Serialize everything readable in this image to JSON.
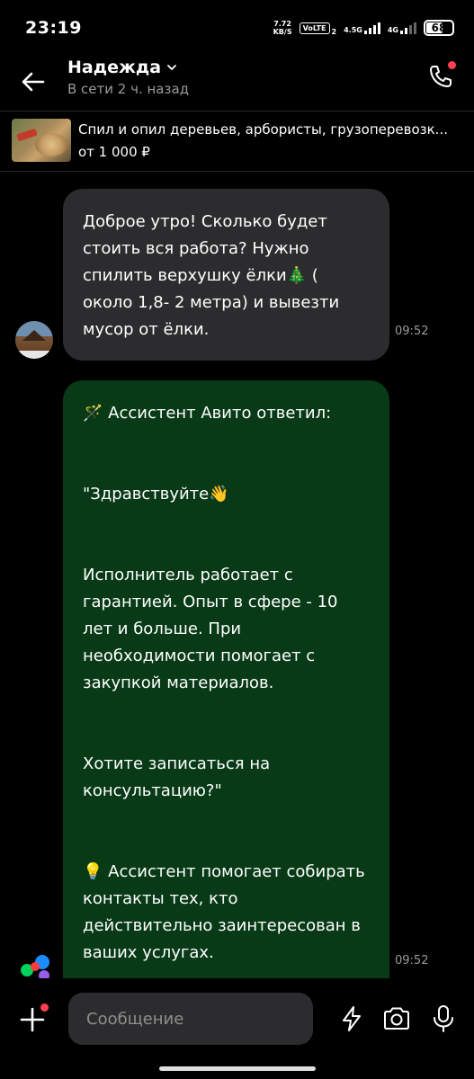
{
  "status_bar": {
    "time": "23:19",
    "speed_value": "7.72",
    "speed_unit": "KB/S",
    "volte": "VoLTE",
    "volte_sim": "2",
    "net1": "4.5G",
    "net2": "4G",
    "battery": "68"
  },
  "header": {
    "contact_name": "Надежда",
    "last_seen": "В сети 2 ч. назад"
  },
  "listing": {
    "title": "Спил и опил деревьев, арбористы, грузоперевозк...",
    "price": "от 1 000 ₽"
  },
  "messages": [
    {
      "text": "Доброе утро! Сколько будет стоить вся работа? Нужно спилить верхушку ёлки🎄 ( около 1,8- 2 метра) и вывезти мусор от ёлки.",
      "time": "09:52"
    },
    {
      "text": "🪄 Ассистент Авито ответил:\n\n\n\"Здравствуйте👋\n\n\nИсполнитель работает с гарантией. Опыт в сфере - 10 лет и больше. При необходимости помогает с закупкой материалов.\n\n\nХотите записаться на консультацию?\"\n\n\n💡 Ассистент помогает собирать контакты тех, кто действительно заинтересован в ваших услугах.",
      "time": "09:52"
    }
  ],
  "input": {
    "placeholder": "Сообщение"
  },
  "colors": {
    "background": "#000000",
    "incoming_bubble": "#2c2c2e",
    "assistant_bubble": "#083a17",
    "accent_dot": "#ff4053",
    "secondary_text": "#9a9a9a"
  },
  "icons": [
    "back-arrow-icon",
    "chevron-down-icon",
    "phone-icon",
    "plus-icon",
    "lightning-icon",
    "camera-icon",
    "microphone-icon",
    "avito-logo-icon"
  ]
}
